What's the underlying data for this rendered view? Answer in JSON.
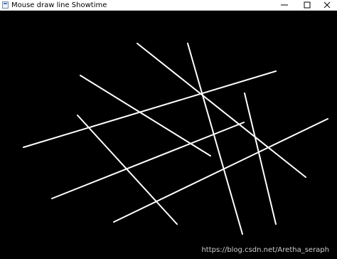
{
  "window": {
    "title": "Mouse draw line Showtime"
  },
  "controls": {
    "minimize_icon": "minimize-icon",
    "maximize_icon": "maximize-icon",
    "close_icon": "close-icon"
  },
  "canvas": {
    "background": "#000000",
    "stroke_color": "#ffffff"
  },
  "watermark": {
    "text": "https://blog.csdn.net/Aretha_seraph"
  }
}
